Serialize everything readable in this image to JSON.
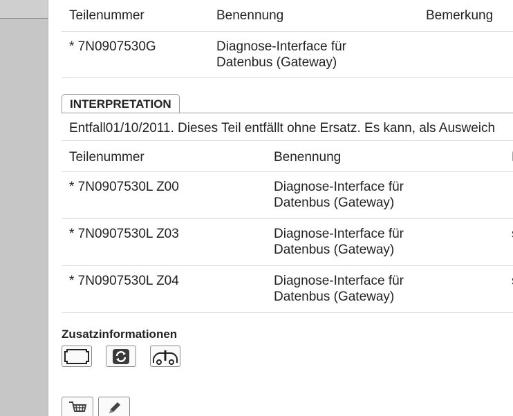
{
  "table1": {
    "headers": [
      "Teilenummer",
      "Benennung",
      "Bemerkung"
    ],
    "rows": [
      {
        "part": "* 7N0907530G",
        "name_line1": "Diagnose-Interface für",
        "name_line2": "Datenbus (Gateway)",
        "remark": ""
      }
    ]
  },
  "interpretation": {
    "tab_label": "INTERPRETATION",
    "text": "Entfall01/10/2011. Dieses Teil entfällt ohne Ersatz. Es kann, als Ausweich"
  },
  "table2": {
    "headers": [
      "Teilenummer",
      "Benennung",
      "B"
    ],
    "rows": [
      {
        "part": "* 7N0907530L Z00",
        "name_line1": "Diagnose-Interface für",
        "name_line2": "Datenbus (Gateway)",
        "remark": ""
      },
      {
        "part": "* 7N0907530L Z03",
        "name_line1": "Diagnose-Interface für",
        "name_line2": "Datenbus (Gateway)",
        "remark": "s"
      },
      {
        "part": "* 7N0907530L Z04",
        "name_line1": "Diagnose-Interface für",
        "name_line2": "Datenbus (Gateway)",
        "remark": "s"
      }
    ]
  },
  "extra": {
    "title": "Zusatzinformationen",
    "icons": [
      "frame-icon",
      "refresh-icon",
      "car-info-icon"
    ]
  },
  "actions": {
    "icons": [
      "shopping-cart-icon",
      "pencil-icon"
    ]
  }
}
